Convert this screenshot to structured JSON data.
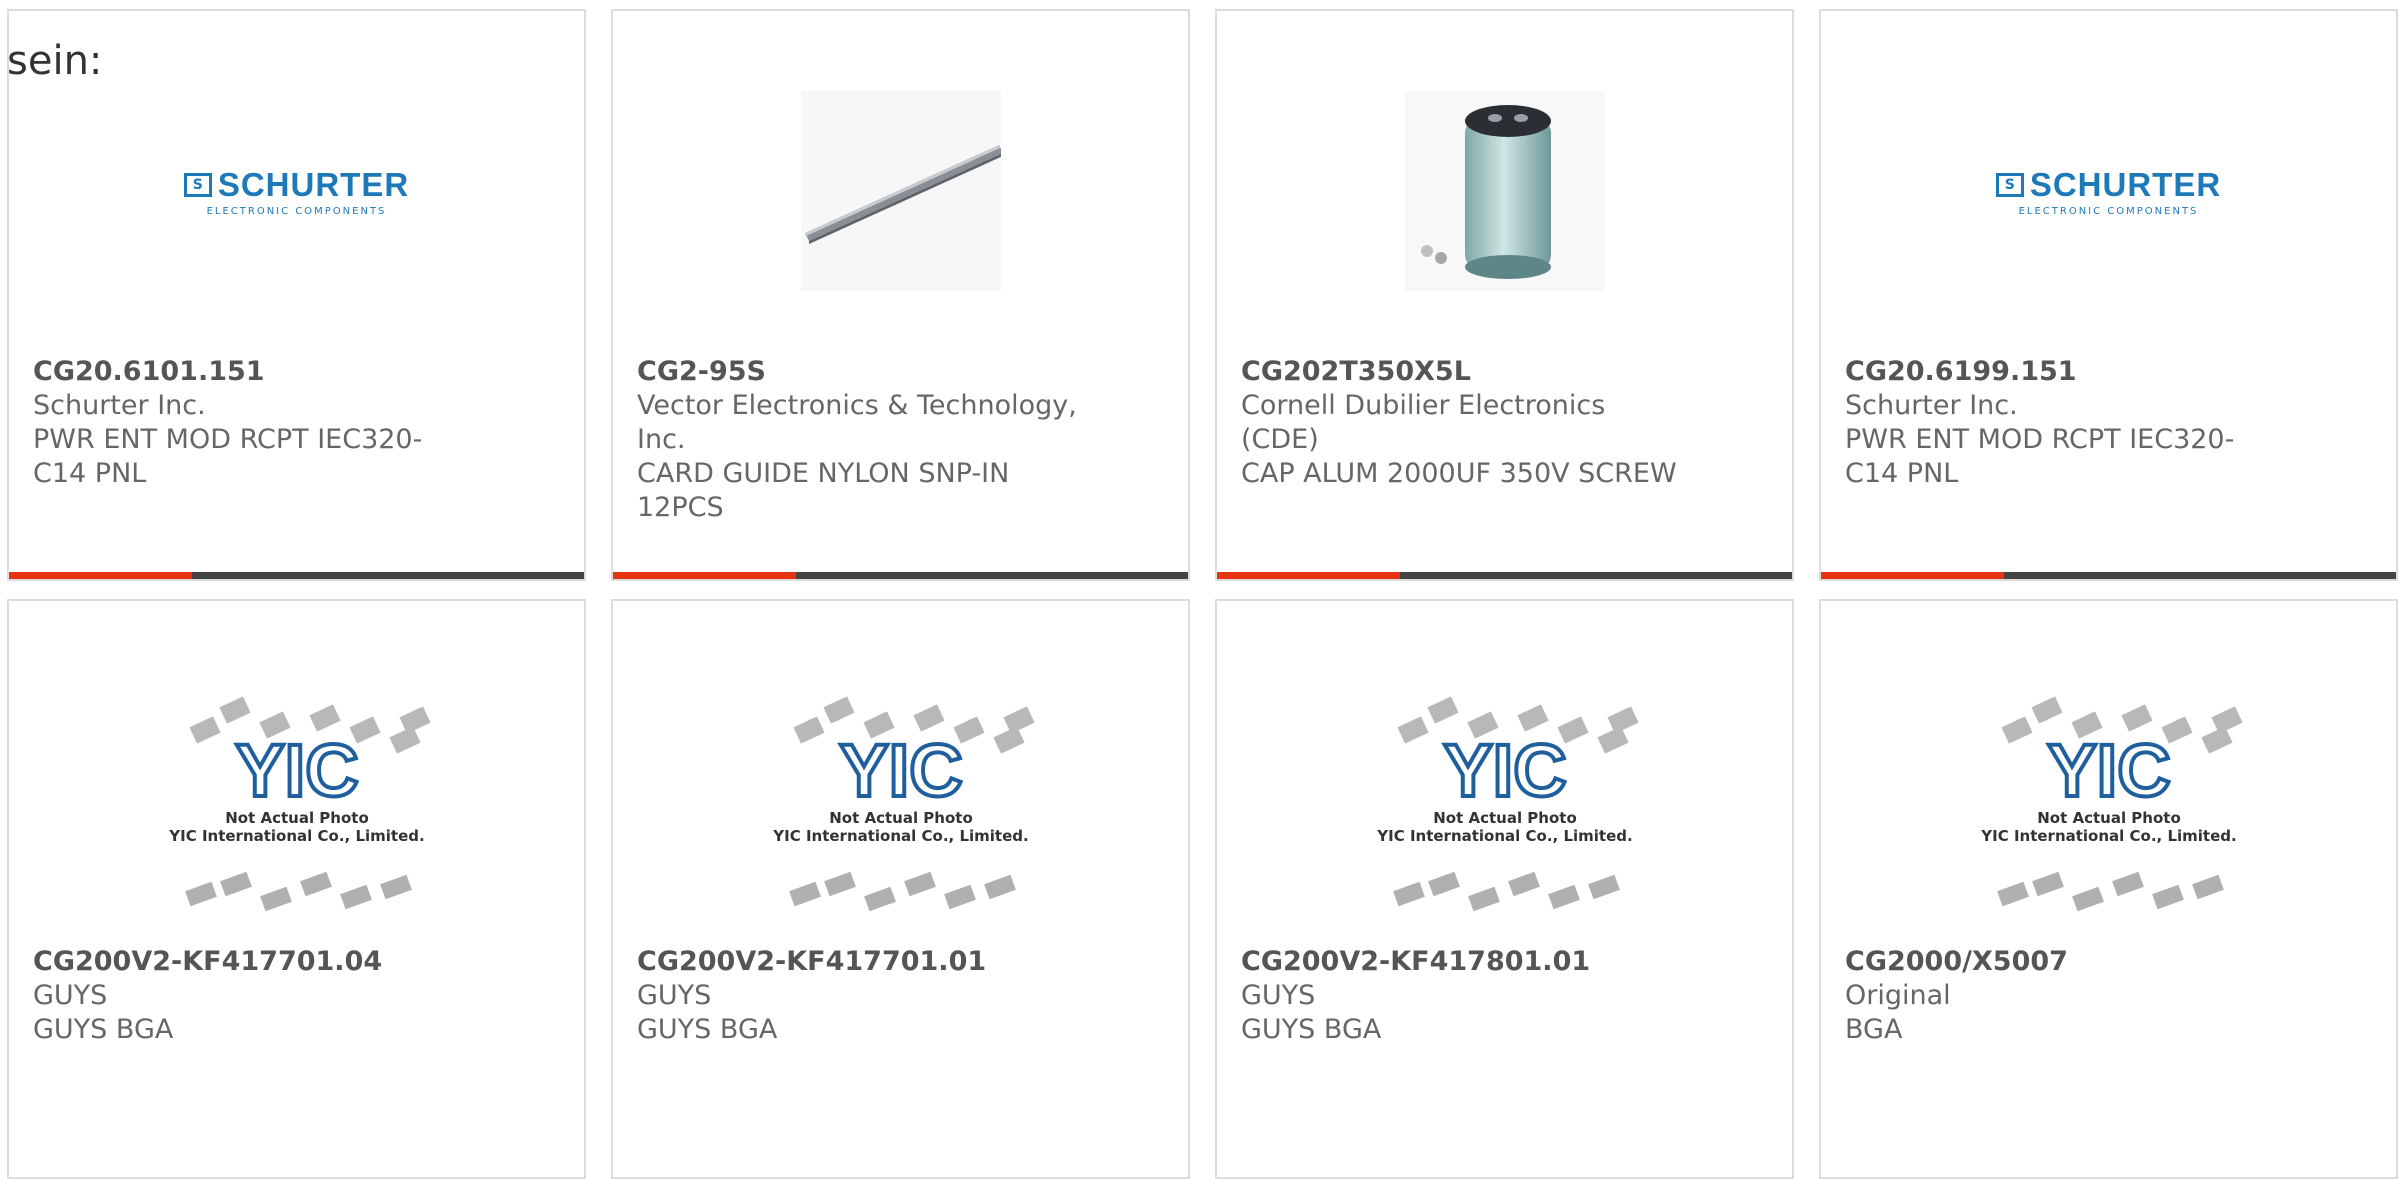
{
  "intro_text": "sein:",
  "colors": {
    "accent": "#e63312",
    "bar": "#444444",
    "border": "#dcdcdc",
    "schurter_blue": "#1e79b9"
  },
  "products": [
    {
      "part": "CG20.6101.151",
      "manufacturer": "Schurter Inc.",
      "description": "PWR ENT MOD RCPT IEC320-C14 PNL",
      "image": "schurter-logo",
      "logo_name": "SCHURTER",
      "logo_sub": "ELECTRONIC COMPONENTS"
    },
    {
      "part": "CG2-95S",
      "manufacturer": "Vector Electronics & Technology, Inc.",
      "description": "CARD GUIDE NYLON SNP-IN 12PCS",
      "image": "card-guide-photo"
    },
    {
      "part": "CG202T350X5L",
      "manufacturer": "Cornell Dubilier Electronics (CDE)",
      "description": "CAP ALUM 2000UF 350V SCREW",
      "image": "capacitor-photo"
    },
    {
      "part": "CG20.6199.151",
      "manufacturer": "Schurter Inc.",
      "description": "PWR ENT MOD RCPT IEC320-C14 PNL",
      "image": "schurter-logo",
      "logo_name": "SCHURTER",
      "logo_sub": "ELECTRONIC COMPONENTS"
    },
    {
      "part": "CG200V2-KF417701.04",
      "manufacturer": "GUYS",
      "description": "GUYS BGA",
      "image": "yic-placeholder",
      "ph_line1": "Not Actual Photo",
      "ph_line2": "YIC International Co., Limited."
    },
    {
      "part": "CG200V2-KF417701.01",
      "manufacturer": "GUYS",
      "description": "GUYS BGA",
      "image": "yic-placeholder",
      "ph_line1": "Not Actual Photo",
      "ph_line2": "YIC International Co., Limited."
    },
    {
      "part": "CG200V2-KF417801.01",
      "manufacturer": "GUYS",
      "description": "GUYS BGA",
      "image": "yic-placeholder",
      "ph_line1": "Not Actual Photo",
      "ph_line2": "YIC International Co., Limited."
    },
    {
      "part": "CG2000/X5007",
      "manufacturer": "Original",
      "description": "BGA",
      "image": "yic-placeholder",
      "ph_line1": "Not Actual Photo",
      "ph_line2": "YIC International Co., Limited."
    }
  ]
}
